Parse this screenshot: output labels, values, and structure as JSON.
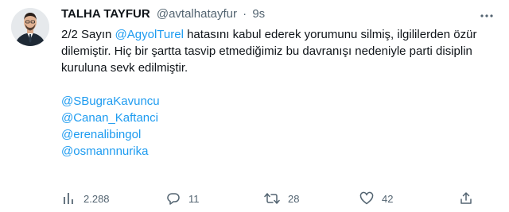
{
  "author": {
    "name": "TALHA TAYFUR",
    "handle": "@avtalhatayfur",
    "separator": "·",
    "time": "9s"
  },
  "tweet": {
    "prefix": "2/2 Sayın ",
    "mention_inline": "@AgyolTurel",
    "text_rest": " hatasını kabul ederek yorumunu silmiş, ilgililerden özür dilemiştir. Hiç bir şartta tasvip etmediğimiz bu davranışı nedeniyle parti disiplin kuruluna sevk edilmiştir.",
    "mentions": [
      "@SBugraKavuncu",
      "@Canan_Kaftanci",
      "@erenalibingol",
      "@osmannnurika"
    ]
  },
  "actions": {
    "views": "2.288",
    "replies": "11",
    "retweets": "28",
    "likes": "42"
  },
  "icons": [
    "analytics-icon",
    "reply-icon",
    "retweet-icon",
    "like-icon",
    "share-icon",
    "more-icon"
  ],
  "colors": {
    "link": "#1d9bf0",
    "secondary": "#536471",
    "text": "#0f1419"
  }
}
